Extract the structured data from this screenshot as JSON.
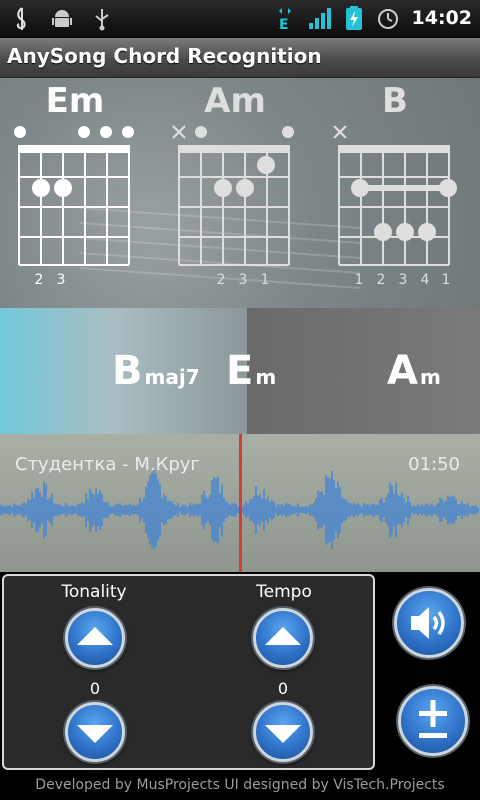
{
  "status_bar": {
    "left_icons": [
      "music-clef-icon",
      "android-icon",
      "usb-icon"
    ],
    "right_icons": [
      "edge-data-icon",
      "signal-icon",
      "battery-charging-icon",
      "alarm-icon"
    ],
    "time": "14:02"
  },
  "app": {
    "title": "AnySong Chord Recognition"
  },
  "chords": [
    {
      "name": "Em",
      "fingers": [
        "2",
        "3"
      ]
    },
    {
      "name": "Am",
      "fingers": [
        "2",
        "3",
        "1"
      ]
    },
    {
      "name": "B",
      "fingers": [
        "1",
        "2",
        "3",
        "4",
        "1"
      ]
    }
  ],
  "progression": [
    {
      "root": "B",
      "quality": "maj7"
    },
    {
      "root": "E",
      "quality": "m"
    },
    {
      "root": "A",
      "quality": "m"
    }
  ],
  "track": {
    "title": "Студентка - М.Круг",
    "duration": "01:50"
  },
  "controls": {
    "tonality_label": "Tonality",
    "tonality_value": "0",
    "tempo_label": "Tempo",
    "tempo_value": "0"
  },
  "footer": {
    "text": "Developed by MusProjects  UI designed by VisTech.Projects"
  },
  "colors": {
    "accent_blue": "#2f73c9",
    "wave_blue": "#4a86d0",
    "playhead_red": "#d63a3a",
    "highlight_cyan": "#72c8da"
  }
}
